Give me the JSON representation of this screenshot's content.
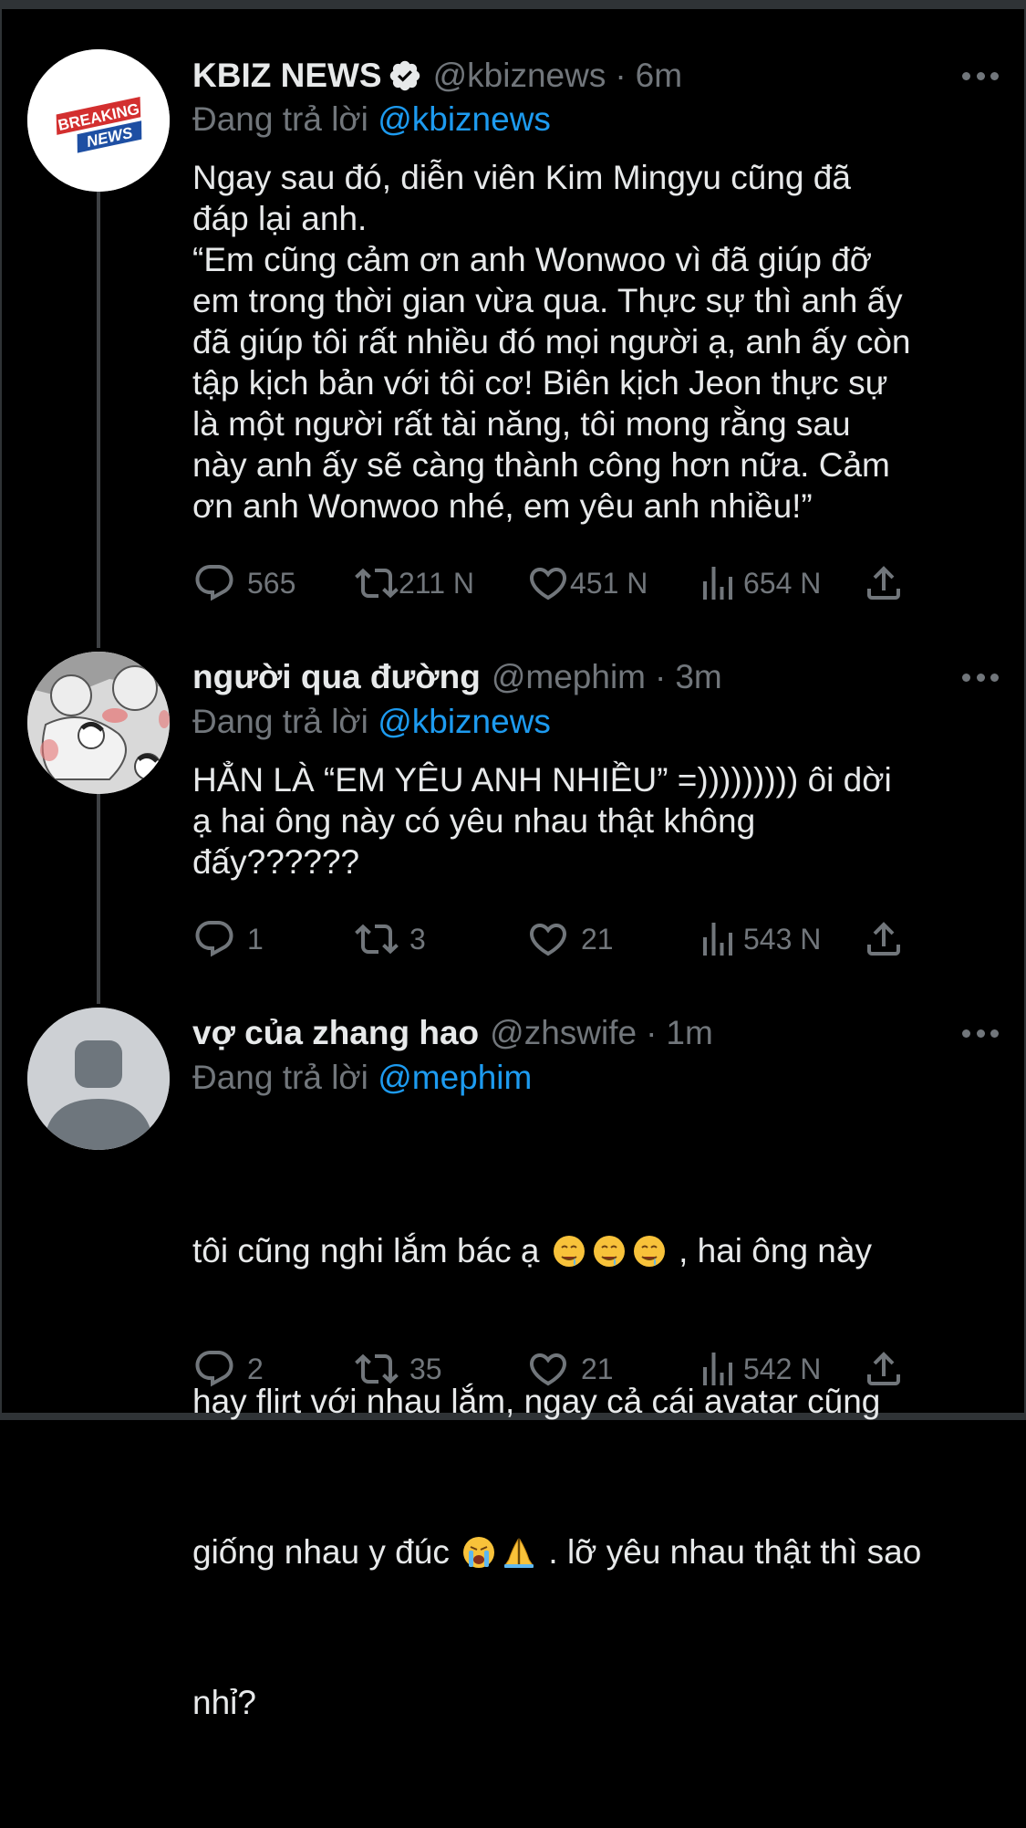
{
  "tweets": [
    {
      "name": "KBIZ NEWS",
      "verified": true,
      "handle": "@kbiznews",
      "separator": "·",
      "time": "6m",
      "replying_prefix": "Đang trả lời",
      "replying_to": "@kbiznews",
      "avatar_text_1": "BREAKING",
      "avatar_text_2": "NEWS",
      "text": "Ngay sau đó, diễn viên Kim Mingyu cũng đã\nđáp lại anh.\n“Em cũng cảm ơn anh Wonwoo vì đã giúp đỡ\nem trong thời gian vừa qua. Thực sự thì anh ấy\nđã giúp tôi rất nhiều đó mọi người ạ, anh ấy còn\ntập kịch bản với tôi cơ! Biên kịch Jeon thực sự\nlà một người rất tài năng, tôi mong rằng sau\nnày anh ấy sẽ càng thành công hơn nữa. Cảm\nơn anh Wonwoo nhé, em yêu anh nhiều!”",
      "replies": "565",
      "retweets": "211 N",
      "likes": "451 N",
      "views": "654 N"
    },
    {
      "name": "người qua đường",
      "verified": false,
      "handle": "@mephim",
      "separator": "·",
      "time": "3m",
      "replying_prefix": "Đang trả lời",
      "replying_to": "@kbiznews",
      "text": "HẲN LÀ “EM YÊU ANH NHIỀU” =))))))))) ôi dời\nạ hai ông này có yêu nhau thật không\nđấy??????",
      "replies": "1",
      "retweets": "3",
      "likes": "21",
      "views": "543 N"
    },
    {
      "name": "vợ của zhang hao",
      "verified": false,
      "handle": "@zhswife",
      "separator": "·",
      "time": "1m",
      "replying_prefix": "Đang trả lời",
      "replying_to": "@mephim",
      "text_parts": {
        "line1_a": "tôi cũng nghi lắm bác ạ ",
        "line1_b": " , hai ông này",
        "line2": "hay flirt với nhau lắm, ngay cả cái avatar cũng",
        "line3_a": "giống nhau y đúc ",
        "line3_b": " . lỡ yêu nhau thật thì sao",
        "line4": "nhỉ?"
      },
      "emoji_names": [
        "drooling-face-icon",
        "loudly-crying-face-icon",
        "folded-hands-icon"
      ],
      "replies": "2",
      "retweets": "35",
      "likes": "21",
      "views": "542 N"
    }
  ],
  "colors": {
    "background": "#000000",
    "text": "#e7e9ea",
    "muted": "#71767b",
    "link": "#1d9bf0",
    "thread_line": "#3e4144"
  }
}
